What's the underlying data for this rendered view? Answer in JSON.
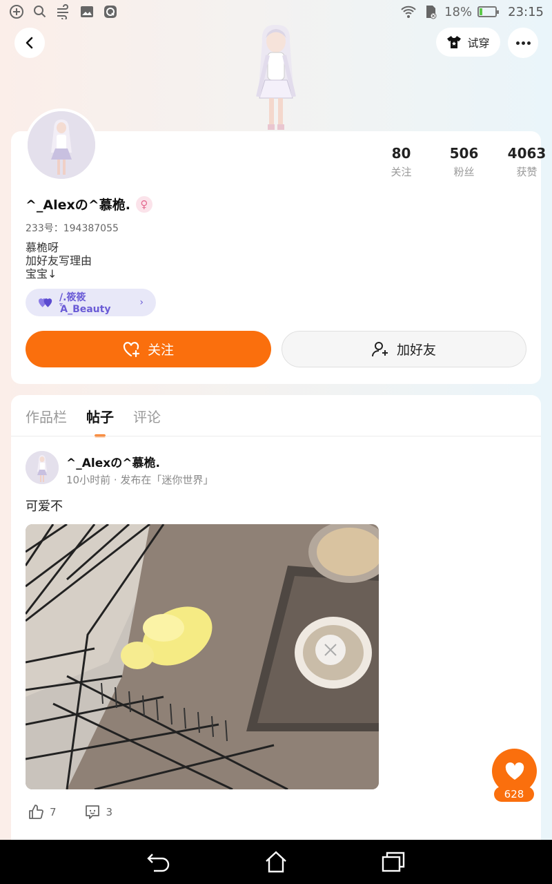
{
  "status_bar": {
    "battery": "18%",
    "time": "23:15",
    "battery_level": 0.18
  },
  "top_bar": {
    "tryon_label": "试穿"
  },
  "profile": {
    "stats": [
      {
        "value": "80",
        "label": "关注"
      },
      {
        "value": "506",
        "label": "粉丝"
      },
      {
        "value": "4063",
        "label": "获赞"
      }
    ],
    "nickname": "^_Alexの^慕桅.",
    "gender_symbol": "♀",
    "uid": "233号：194387055",
    "bio_lines": [
      "慕桅呀",
      "加好友写理由",
      "宝宝↓"
    ],
    "medal_label": "/.筱筱Ἇ_Beauty",
    "follow_label": "关注",
    "add_friend_label": "加好友"
  },
  "tabs": [
    {
      "label": "作品栏",
      "active": false
    },
    {
      "label": "帖子",
      "active": true
    },
    {
      "label": "评论",
      "active": false
    }
  ],
  "post": {
    "author": "^_Alexの^慕桅.",
    "meta": "10小时前 · 发布在「迷你世界」",
    "text": "可爱不",
    "likes": "7",
    "comments": "3"
  },
  "floating_like": {
    "count": "628"
  },
  "colors": {
    "accent": "#fa6f0d",
    "medal_text": "#6a5bd6",
    "medal_bg": "#e8e8f8"
  }
}
